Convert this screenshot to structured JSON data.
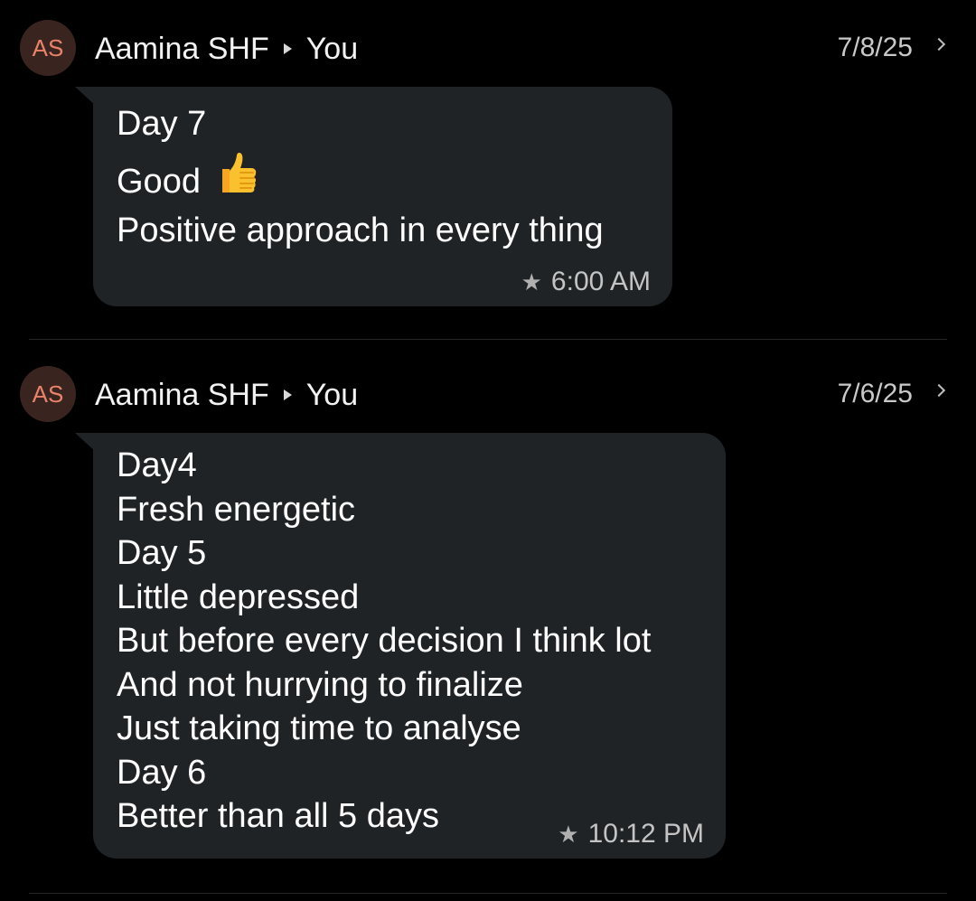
{
  "threads": [
    {
      "avatar_initials": "AS",
      "sender": "Aamina SHF",
      "recipient": "You",
      "date": "7/8/25",
      "lines": [
        "Day 7",
        "Good",
        "Positive approach in every thing"
      ],
      "emoji": "thumbs-up",
      "time": "6:00 AM",
      "starred": true
    },
    {
      "avatar_initials": "AS",
      "sender": "Aamina SHF",
      "recipient": "You",
      "date": "7/6/25",
      "lines": [
        "Day4",
        "Fresh energetic",
        "Day 5",
        "Little depressed",
        "But before every decision I think lot",
        "And not hurrying to finalize",
        "Just taking time to analyse",
        "Day 6",
        "Better than all 5 days"
      ],
      "time": "10:12 PM",
      "starred": true
    }
  ],
  "colors": {
    "background": "#000000",
    "bubble": "#1f2326",
    "avatar_bg": "#3a2420",
    "avatar_text": "#e8836a",
    "meta_text": "#c4c4c4"
  }
}
